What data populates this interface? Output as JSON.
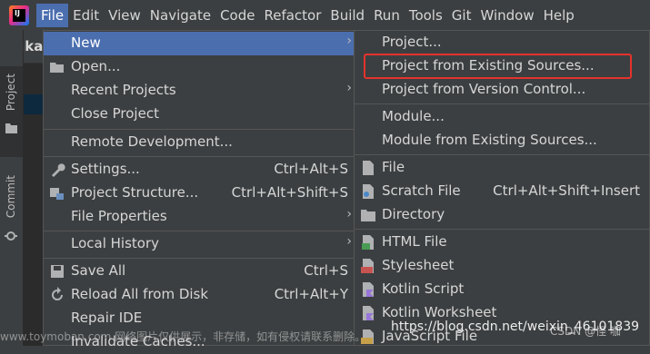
{
  "menubar": {
    "logo_text": "IJ",
    "items": [
      "File",
      "Edit",
      "View",
      "Navigate",
      "Code",
      "Refactor",
      "Build",
      "Run",
      "Tools",
      "Git",
      "Window",
      "Help"
    ]
  },
  "sidebar": {
    "project_tab": "Project",
    "commit_tab": "Commit",
    "project_name": "jakar"
  },
  "file_menu": [
    {
      "label": "New",
      "shortcut": "",
      "submenu": true,
      "selected": true,
      "icon": ""
    },
    {
      "label": "Open...",
      "shortcut": "",
      "submenu": false,
      "icon": "folder-icon"
    },
    {
      "label": "Recent Projects",
      "shortcut": "",
      "submenu": true,
      "icon": ""
    },
    {
      "label": "Close Project",
      "shortcut": "",
      "submenu": false,
      "icon": ""
    },
    {
      "label": "Remote Development...",
      "shortcut": "",
      "submenu": false,
      "icon": ""
    },
    {
      "label": "Settings...",
      "shortcut": "Ctrl+Alt+S",
      "submenu": false,
      "icon": "wrench-icon"
    },
    {
      "label": "Project Structure...",
      "shortcut": "Ctrl+Alt+Shift+S",
      "submenu": false,
      "icon": "project-structure-icon"
    },
    {
      "label": "File Properties",
      "shortcut": "",
      "submenu": true,
      "icon": ""
    },
    {
      "label": "Local History",
      "shortcut": "",
      "submenu": true,
      "icon": ""
    },
    {
      "label": "Save All",
      "shortcut": "Ctrl+S",
      "submenu": false,
      "icon": "save-icon"
    },
    {
      "label": "Reload All from Disk",
      "shortcut": "Ctrl+Alt+Y",
      "submenu": false,
      "icon": "reload-icon"
    },
    {
      "label": "Repair IDE",
      "shortcut": "",
      "submenu": false,
      "icon": ""
    },
    {
      "label": "Invalidate Caches...",
      "shortcut": "",
      "submenu": false,
      "icon": ""
    }
  ],
  "new_submenu": [
    {
      "label": "Project...",
      "shortcut": "",
      "icon": ""
    },
    {
      "label": "Project from Existing Sources...",
      "shortcut": "",
      "icon": "",
      "highlighted": true
    },
    {
      "label": "Project from Version Control...",
      "shortcut": "",
      "icon": ""
    },
    {
      "label": "Module...",
      "shortcut": "",
      "icon": ""
    },
    {
      "label": "Module from Existing Sources...",
      "shortcut": "",
      "icon": ""
    },
    {
      "label": "File",
      "shortcut": "",
      "icon": "file-icon"
    },
    {
      "label": "Scratch File",
      "shortcut": "Ctrl+Alt+Shift+Insert",
      "icon": "scratch-file-icon"
    },
    {
      "label": "Directory",
      "shortcut": "",
      "icon": "directory-icon"
    },
    {
      "label": "HTML File",
      "shortcut": "",
      "icon": "html-file-icon"
    },
    {
      "label": "Stylesheet",
      "shortcut": "",
      "icon": "css-file-icon"
    },
    {
      "label": "Kotlin Script",
      "shortcut": "",
      "icon": "kotlin-icon"
    },
    {
      "label": "Kotlin Worksheet",
      "shortcut": "",
      "icon": "kotlin-icon"
    },
    {
      "label": "JavaScript File",
      "shortcut": "",
      "icon": "js-file-icon"
    }
  ],
  "watermark": "https://blog.csdn.net/weixin_46101839",
  "watermark_cn": "www.toymoban.com 网络图片仅供展示，非存储，如有侵权请联系删除。",
  "csdn_mark": "CSDN @怪 咖"
}
